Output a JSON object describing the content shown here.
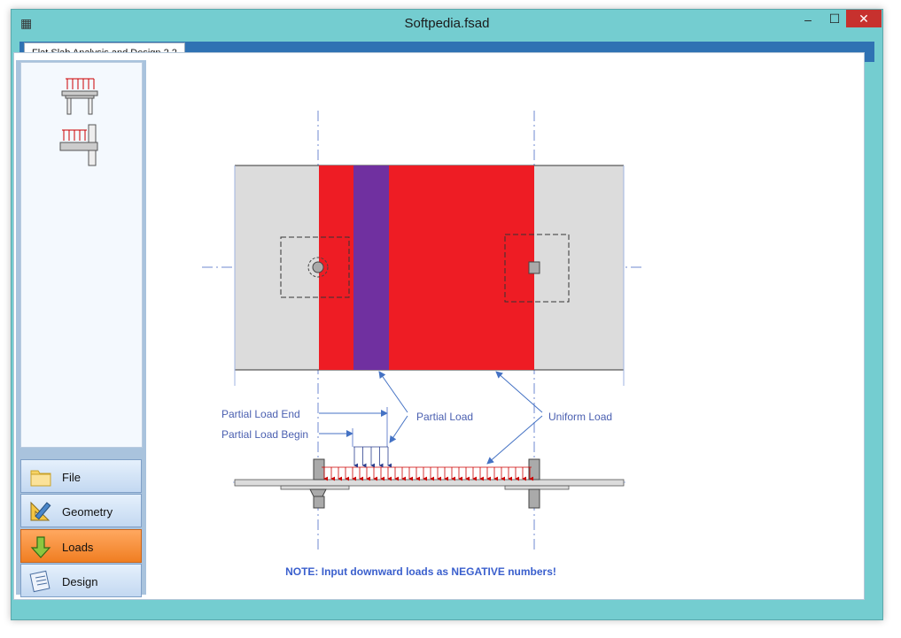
{
  "window": {
    "title": "Softpedia.fsad",
    "app_icon": "table-icon",
    "controls": {
      "minimize": "–",
      "maximize": "☐",
      "close": "✕"
    }
  },
  "tab": {
    "label": "Flat Slab Analysis and Design 2.2"
  },
  "sidebar": {
    "load_types": [
      {
        "name": "internal-column-load-icon"
      },
      {
        "name": "edge-column-load-icon"
      }
    ],
    "nav": [
      {
        "label": "File",
        "icon": "folder-icon"
      },
      {
        "label": "Geometry",
        "icon": "geometry-icon"
      },
      {
        "label": "Loads",
        "icon": "down-arrow-icon",
        "active": true
      },
      {
        "label": "Design",
        "icon": "design-icon"
      }
    ]
  },
  "diagram": {
    "labels": {
      "partial_load_end": "Partial Load End",
      "partial_load_begin": "Partial Load Begin",
      "partial_load": "Partial Load",
      "uniform_load": "Uniform Load"
    },
    "note": "NOTE: Input downward loads as NEGATIVE numbers!",
    "colors": {
      "uniform": "#ee1c24",
      "partial": "#7030a0",
      "slab": "#dcdcdc",
      "arrow": "#4472c4"
    }
  }
}
